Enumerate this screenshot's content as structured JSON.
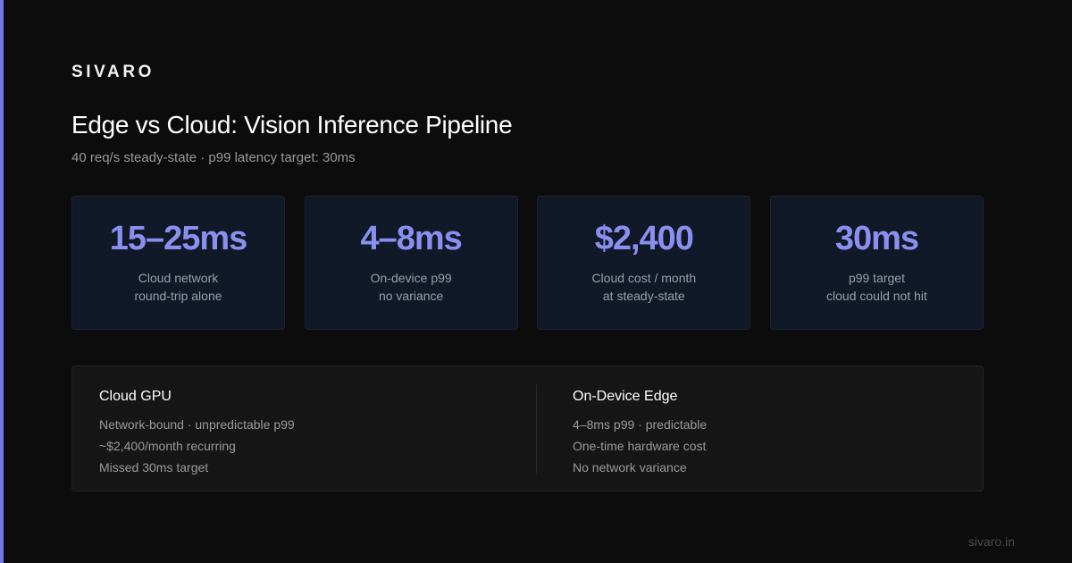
{
  "brand": "SIVARO",
  "title": "Edge vs Cloud: Vision Inference Pipeline",
  "subtitle": "40 req/s steady-state · p99 latency target: 30ms",
  "accent_color": "#6f78e8",
  "stat_value_color": "#8a90ef",
  "stats": [
    {
      "value": "15–25ms",
      "label_line1": "Cloud network",
      "label_line2": "round-trip alone"
    },
    {
      "value": "4–8ms",
      "label_line1": "On-device p99",
      "label_line2": "no variance"
    },
    {
      "value": "$2,400",
      "label_line1": "Cloud cost / month",
      "label_line2": "at steady-state"
    },
    {
      "value": "30ms",
      "label_line1": "p99 target",
      "label_line2": "cloud could not hit"
    }
  ],
  "comparison": {
    "left": {
      "heading": "Cloud GPU",
      "items": [
        "Network-bound · unpredictable p99",
        "~$2,400/month recurring",
        "Missed 30ms target"
      ]
    },
    "right": {
      "heading": "On-Device Edge",
      "items": [
        "4–8ms p99 · predictable",
        "One-time hardware cost",
        "No network variance"
      ]
    }
  },
  "footer": "sivaro.in"
}
